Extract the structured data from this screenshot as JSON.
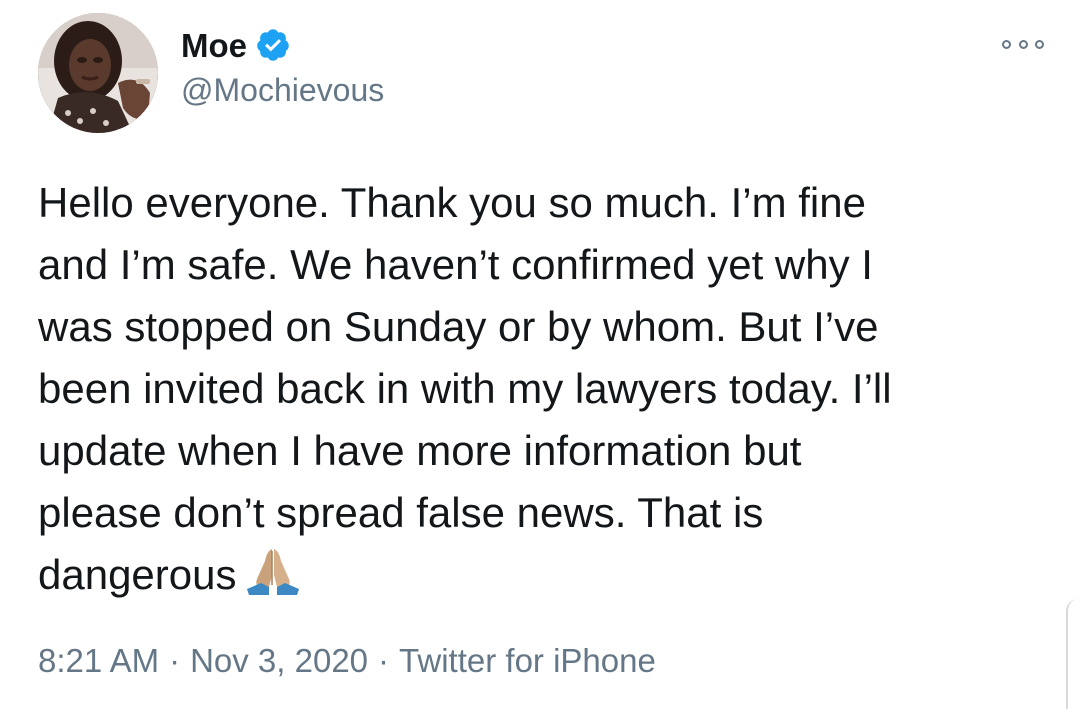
{
  "author": {
    "display_name": "Moe",
    "handle": "@Mochievous",
    "verified": true
  },
  "tweet": {
    "text": "Hello everyone. Thank you so much. I’m fine\nand I’m safe. We haven’t confirmed yet why I\nwas stopped on Sunday or by whom. But I’ve\nbeen invited back in with my lawyers today. I’ll\nupdate when I have more information but\nplease don’t spread false news. That is\ndangerous",
    "emoji": "folded-hands-emoji"
  },
  "meta": {
    "time": "8:21 AM",
    "separator": "·",
    "date": "Nov 3, 2020",
    "source": "Twitter for iPhone"
  },
  "colors": {
    "verified_blue": "#1da1f2",
    "secondary_text": "#657786",
    "primary_text": "#14171a"
  },
  "icons": {
    "verified": "verified-badge-icon",
    "more": "more-options-icon"
  }
}
